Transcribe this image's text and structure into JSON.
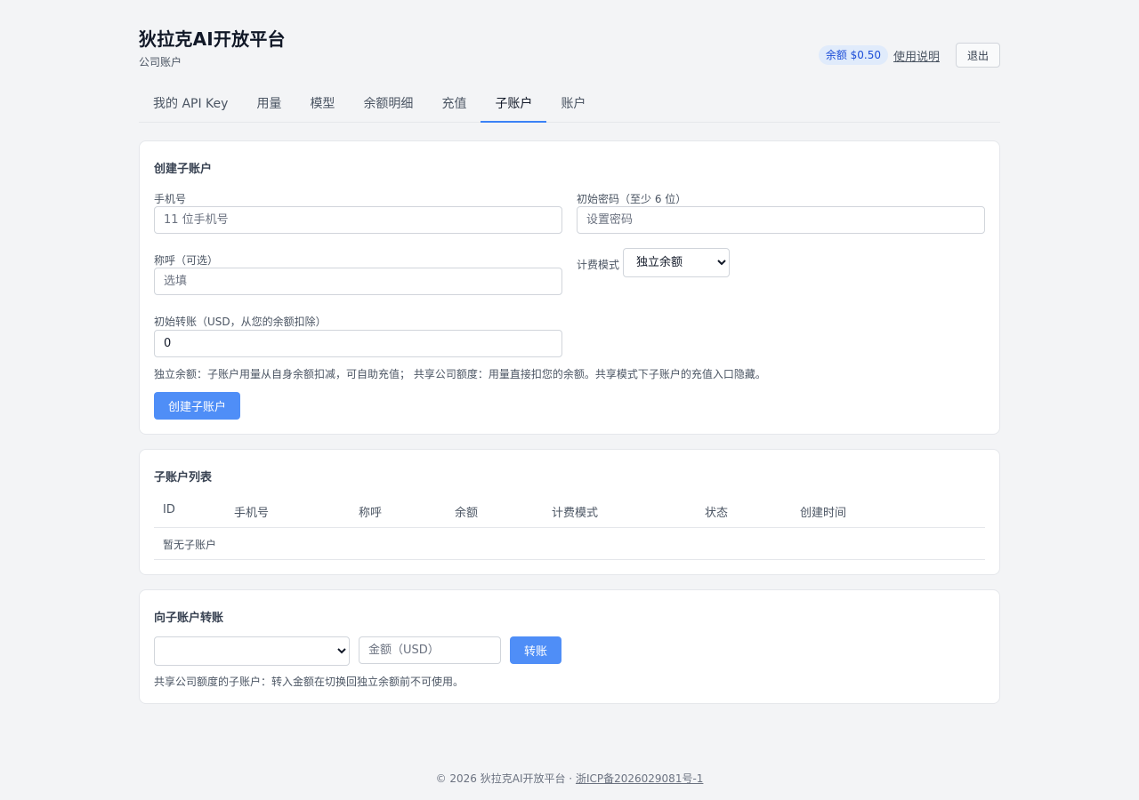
{
  "header": {
    "title": "狄拉克AI开放平台",
    "subtitle": "公司账户",
    "balance": "余额 $0.50",
    "help_link": "使用说明",
    "logout": "退出"
  },
  "tabs": [
    {
      "label": "我的 API Key",
      "active": false
    },
    {
      "label": "用量",
      "active": false
    },
    {
      "label": "模型",
      "active": false
    },
    {
      "label": "余额明细",
      "active": false
    },
    {
      "label": "充值",
      "active": false
    },
    {
      "label": "子账户",
      "active": true
    },
    {
      "label": "账户",
      "active": false
    }
  ],
  "create": {
    "title": "创建子账户",
    "phone_label": "手机号",
    "phone_placeholder": "11 位手机号",
    "password_label": "初始密码（至少 6 位）",
    "password_placeholder": "设置密码",
    "nickname_label": "称呼（可选）",
    "nickname_placeholder": "选填",
    "billing_label": "计费模式",
    "billing_selected": "独立余额",
    "transfer_label": "初始转账（USD，从您的余额扣除）",
    "transfer_value": "0",
    "hint": "独立余额：子账户用量从自身余额扣减，可自助充值；  共享公司额度：用量直接扣您的余额。共享模式下子账户的充值入口隐藏。",
    "submit": "创建子账户"
  },
  "list": {
    "title": "子账户列表",
    "columns": [
      "ID",
      "手机号",
      "称呼",
      "余额",
      "计费模式",
      "状态",
      "创建时间"
    ],
    "empty": "暂无子账户"
  },
  "transfer": {
    "title": "向子账户转账",
    "amount_placeholder": "金额（USD）",
    "submit": "转账",
    "hint": "共享公司额度的子账户：转入金额在切换回独立余额前不可使用。"
  },
  "footer": {
    "copyright": "© 2026 狄拉克AI开放平台 · ",
    "icp": "浙ICP备2026029081号-1"
  },
  "colors": {
    "accent": "#3b82f6",
    "button": "#4f8ef7",
    "badge_bg": "#e0ebfb",
    "page_bg": "#f3f4f6"
  }
}
